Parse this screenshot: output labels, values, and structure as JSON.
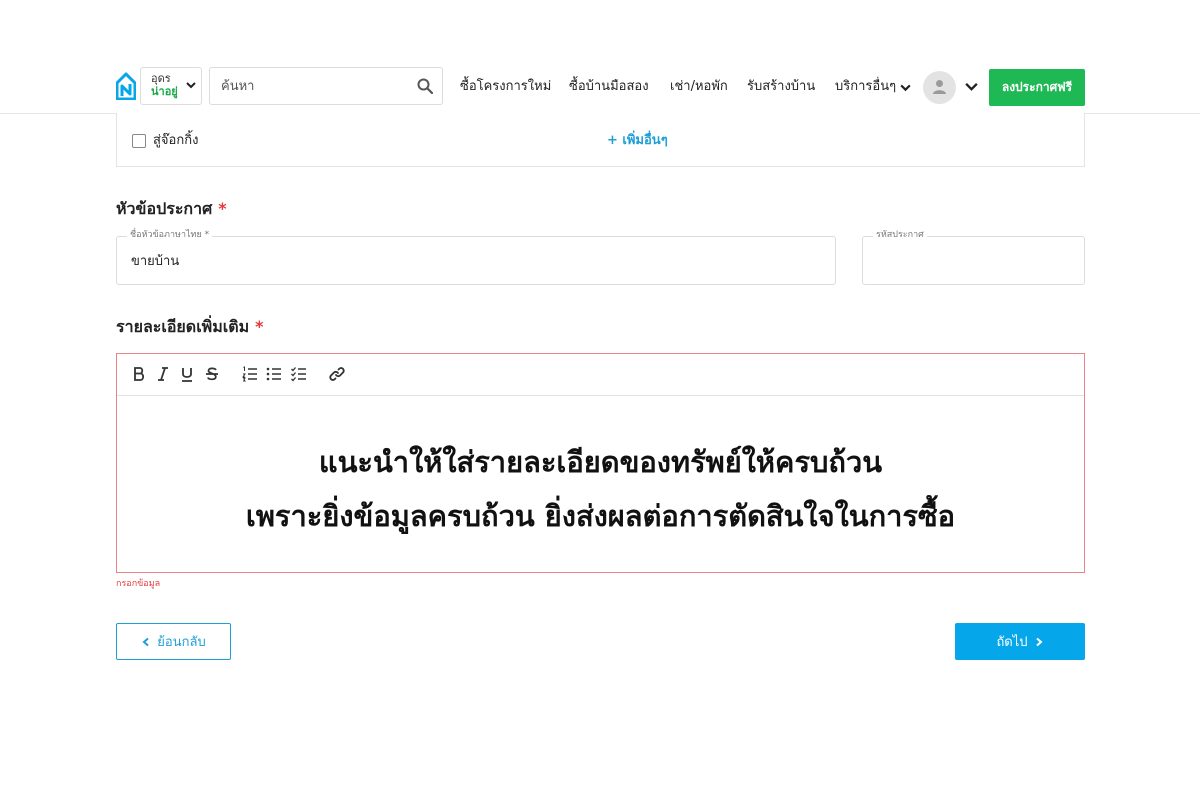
{
  "header": {
    "province": {
      "name": "อุดร",
      "tagline": "น่าอยู่"
    },
    "search": {
      "placeholder": "ค้นหา"
    },
    "nav": [
      {
        "label": "ซื้อโครงการใหม่"
      },
      {
        "label": "ซื้อบ้านมือสอง"
      },
      {
        "label": "เช่า/หอพัก"
      },
      {
        "label": "รับสร้างบ้าน"
      },
      {
        "label": "บริการอื่นๆ"
      }
    ],
    "post_button": "ลงประกาศฟรี"
  },
  "features": {
    "checkbox_label": "สู่จ๊อกกิ้ง",
    "add_more": "+ เพิ่มอื่นๆ"
  },
  "title_section": {
    "heading": "หัวข้อประกาศ",
    "required_mark": "*",
    "thai_title": {
      "label": "ชื่อหัวข้อภาษาไทย *",
      "value": "ขายบ้าน"
    },
    "code": {
      "label": "รหัสประกาศ",
      "value": ""
    }
  },
  "details_section": {
    "heading": "รายละเอียดเพิ่มเติม",
    "required_mark": "*",
    "toolbar": [
      "bold-icon",
      "italic-icon",
      "underline-icon",
      "strikethrough-icon",
      "ordered-list-icon",
      "bullet-list-icon",
      "checklist-icon",
      "link-icon"
    ],
    "editor_lines": [
      "แนะนำให้ใส่รายละเอียดของทรัพย์ให้ครบถ้วน",
      "เพราะยิ่งข้อมูลครบถ้วน ยิ่งส่งผลต่อการตัดสินใจในการซื้อ"
    ],
    "error": "กรอกข้อมูล"
  },
  "footer": {
    "back_label": "ย้อนกลับ",
    "next_label": "ถัดไป"
  },
  "colors": {
    "brand_blue": "#06a7ea",
    "green": "#1eb854",
    "error_red": "#e5383b",
    "editor_border": "#e7868a"
  }
}
